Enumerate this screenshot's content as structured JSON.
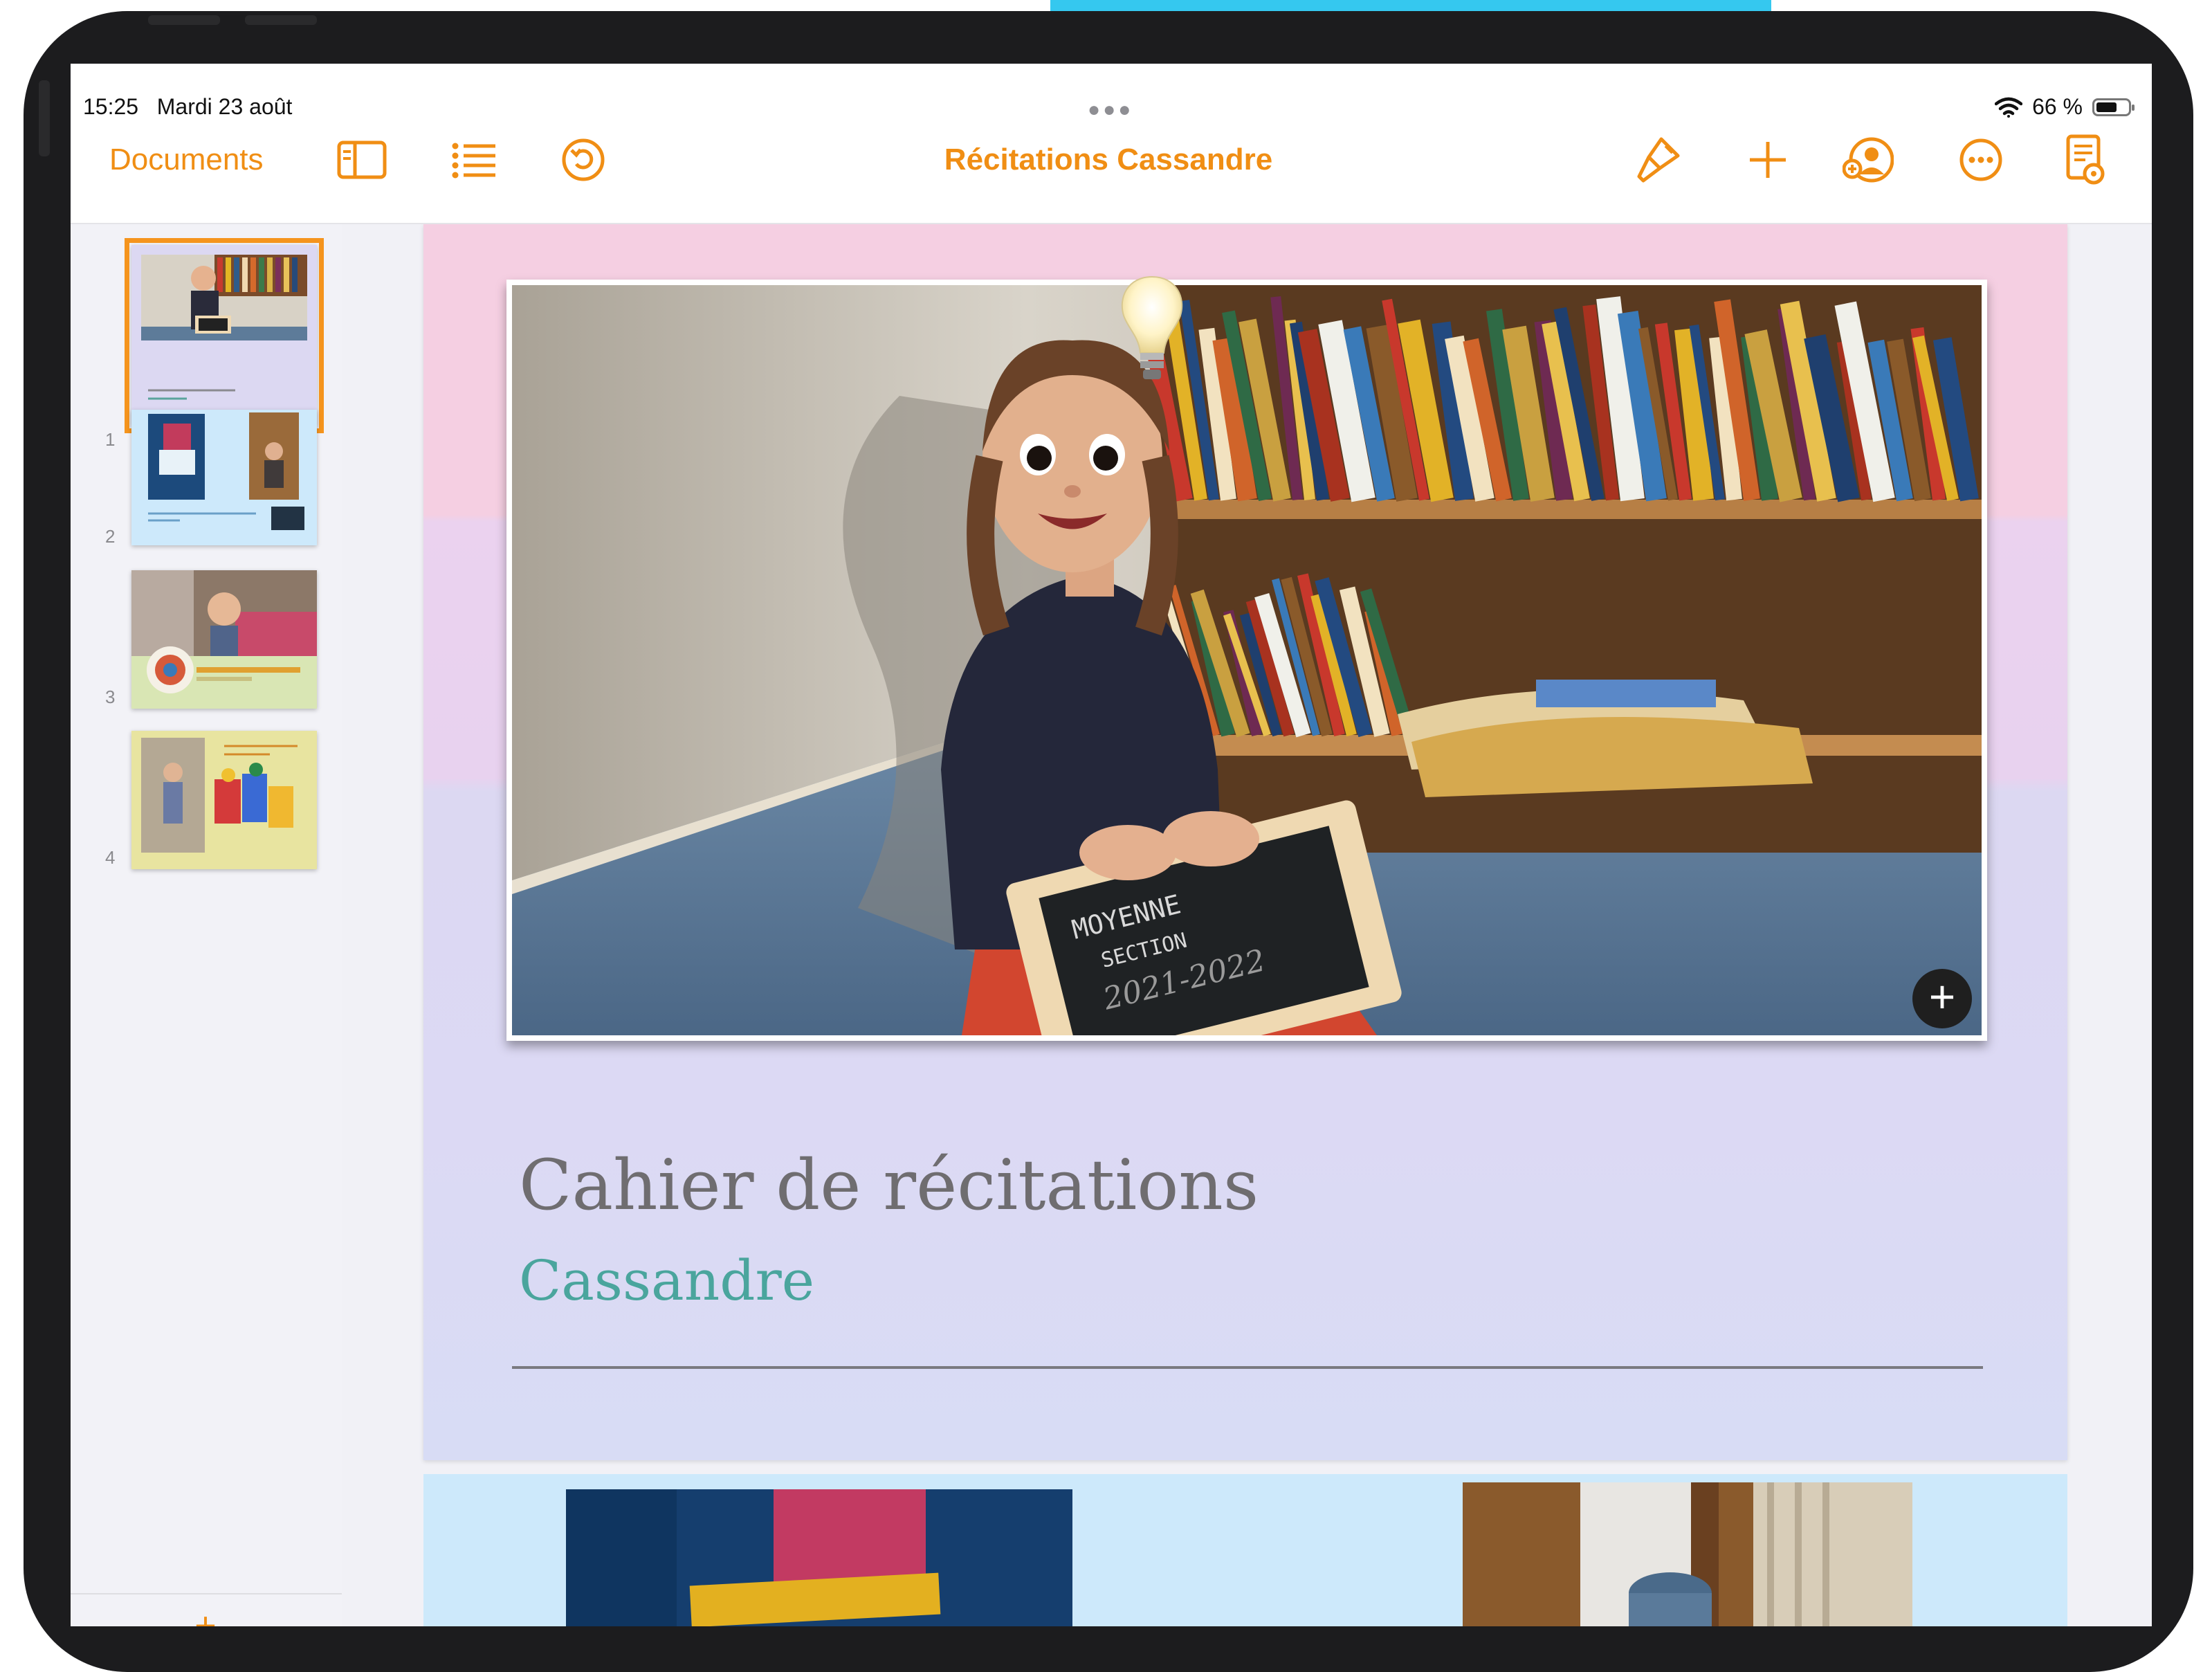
{
  "status": {
    "time": "15:25",
    "date": "Mardi 23 août",
    "battery": "66 %",
    "battery_level": 0.66
  },
  "toolbar": {
    "documents_label": "Documents",
    "title": "Récitations Cassandre",
    "accent_color": "#f08e14"
  },
  "slides": [
    {
      "number": "1",
      "selected": true
    },
    {
      "number": "2",
      "selected": false
    },
    {
      "number": "3",
      "selected": false
    },
    {
      "number": "4",
      "selected": false
    }
  ],
  "slide1": {
    "title": "Cahier de récitations",
    "subtitle": "Cassandre",
    "slate_text": [
      "MOYENNE",
      "SECTION",
      "2021-2022"
    ]
  },
  "icons": [
    "sidebar-toggle-icon",
    "list-icon",
    "undo-icon",
    "brush-icon",
    "plus-icon",
    "collaborate-icon",
    "more-icon",
    "document-view-icon",
    "wifi-icon",
    "battery-icon",
    "lightbulb-icon"
  ]
}
